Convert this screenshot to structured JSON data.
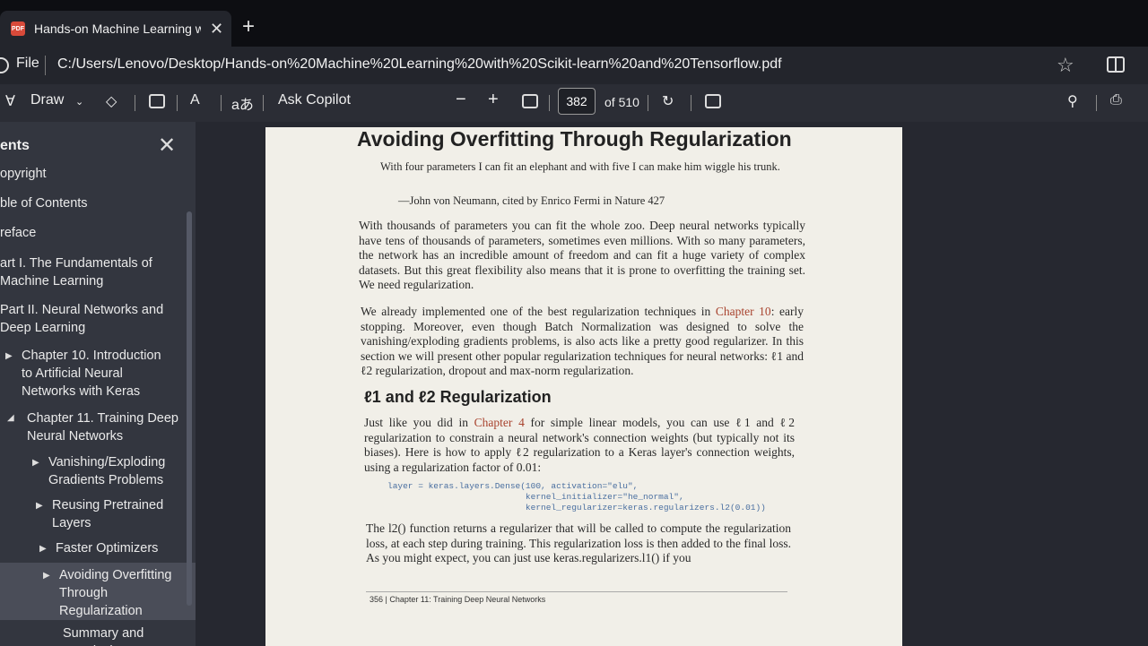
{
  "tab": {
    "title": "Hands-on Machine Learning wit"
  },
  "address": {
    "label": "File",
    "url": "C:/Users/Lenovo/Desktop/Hands-on%20Machine%20Learning%20with%20Scikit-learn%20and%20Tensorflow.pdf"
  },
  "toolbar": {
    "draw": "Draw",
    "ask_copilot": "Ask Copilot",
    "zoom_out": "−",
    "zoom_in": "+",
    "page_number": "382",
    "page_total": "of 510",
    "text_size": "A",
    "translate": "aあ"
  },
  "sidebar": {
    "header": "ents",
    "items": [
      "opyright",
      "ble of Contents",
      "reface",
      "art I. The Fundamentals of Machine Learning",
      "Part II. Neural Networks and Deep Learning",
      "Chapter 10. Introduction to Artificial Neural Networks with Keras",
      "Chapter 11. Training Deep Neural Networks",
      "Vanishing/Exploding Gradients Problems",
      "Reusing Pretrained Layers",
      "Faster Optimizers",
      "Avoiding Overfitting Through Regularization",
      "Summary and Practical"
    ]
  },
  "document": {
    "heading": "Avoiding Overfitting Through Regularization",
    "quote": "With four parameters I can fit an elephant and with five I can make him wiggle his trunk.",
    "attribution": "—John von Neumann, cited by Enrico Fermi in Nature 427",
    "para1": "With thousands of parameters you can fit the whole zoo. Deep neural networks typically have tens of thousands of parameters, sometimes even millions. With so many parameters, the network has an incredible amount of freedom and can fit a huge variety of complex datasets. But this great flexibility also means that it is prone to overfitting the training set. We need regularization.",
    "para2_a": "We already implemented one of the best regularization techniques in ",
    "para2_link": "Chapter 10",
    "para2_b": ": early stopping. Moreover, even though Batch Normalization was designed to solve the vanishing/exploding gradients problems, is also acts like a pretty good regularizer. In this section we will present other popular regularization techniques for neural networks: ℓ1 and ℓ2 regularization, dropout and max-norm regularization.",
    "subheading": "ℓ1 and ℓ2 Regularization",
    "para3_a": "Just like you did in ",
    "para3_link": "Chapter 4",
    "para3_b": " for simple linear models, you can use ℓ1 and ℓ2 regularization to constrain a neural network's connection weights (but typically not its biases). Here is how to apply ℓ2 regularization to a Keras layer's connection weights, using a regularization factor of 0.01:",
    "code": "layer = keras.layers.Dense(100, activation=\"elu\",\n                           kernel_initializer=\"he_normal\",\n                           kernel_regularizer=keras.regularizers.l2(0.01))",
    "para4": "The l2() function returns a regularizer that will be called to compute the regularization loss, at each step during training. This regularization loss is then added to the final loss. As you might expect, you can just use keras.regularizers.l1() if you",
    "footer": "356   |   Chapter 11: Training Deep Neural Networks"
  }
}
